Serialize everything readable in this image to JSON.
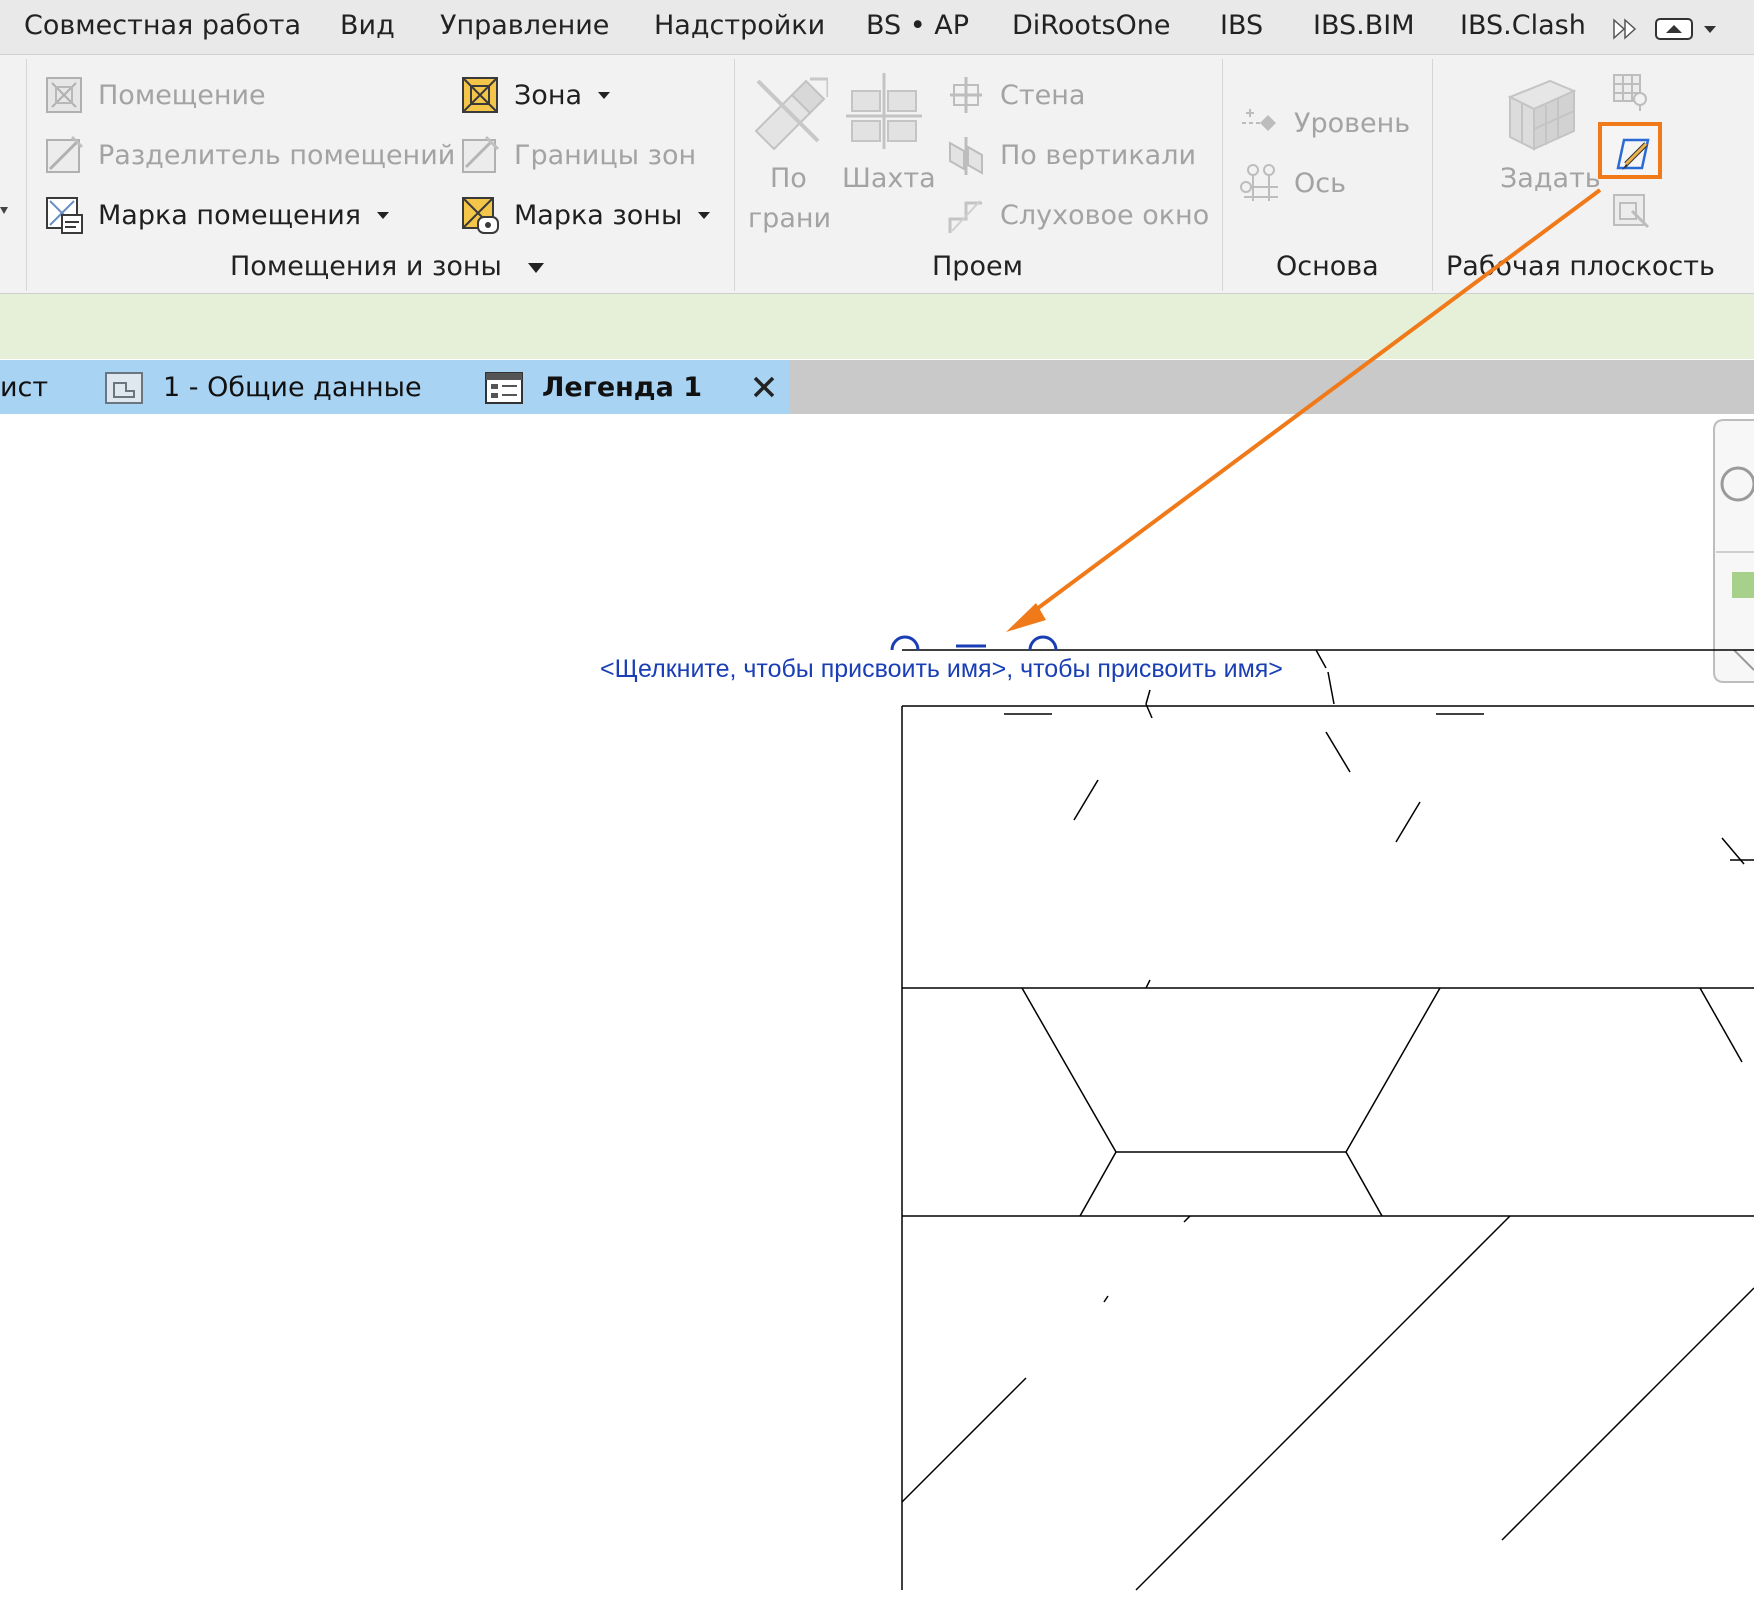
{
  "menu": {
    "tabs": [
      "Совместная работа",
      "Вид",
      "Управление",
      "Надстройки",
      "BS • AP",
      "DiRootsOne",
      "IBS",
      "IBS.BIM",
      "IBS.Clash"
    ]
  },
  "ribbon": {
    "rooms_panel": {
      "title": "Помещения и зоны",
      "room": "Помещение",
      "room_separator": "Разделитель помещений",
      "room_tag": "Марка помещения",
      "zone": "Зона",
      "zone_boundaries": "Границы  зон",
      "zone_tag": "Марка  зоны"
    },
    "opening_panel": {
      "title": "Проем",
      "by_face_line1": "По",
      "by_face_line2": "грани",
      "shaft": "Шахта",
      "wall": "Стена",
      "vertical": "По вертикали",
      "dormer": "Слуховое окно"
    },
    "datum_panel": {
      "title": "Основа",
      "level": "Уровень",
      "grid": "Ось"
    },
    "workplane_panel": {
      "title": "Рабочая плоскость",
      "set": "Задать"
    }
  },
  "view_tabs": {
    "partial_tab": "ист",
    "tab1": "1 - Общие данные",
    "tab2": "Легенда 1"
  },
  "canvas": {
    "legend_name": "<Щелкните, чтобы присвоить имя>, чтобы присвоить имя>"
  },
  "colors": {
    "annotation_arrow": "#f07a1a",
    "highlight_box": "#f07a1a",
    "legend_text": "#1a3fb5"
  }
}
